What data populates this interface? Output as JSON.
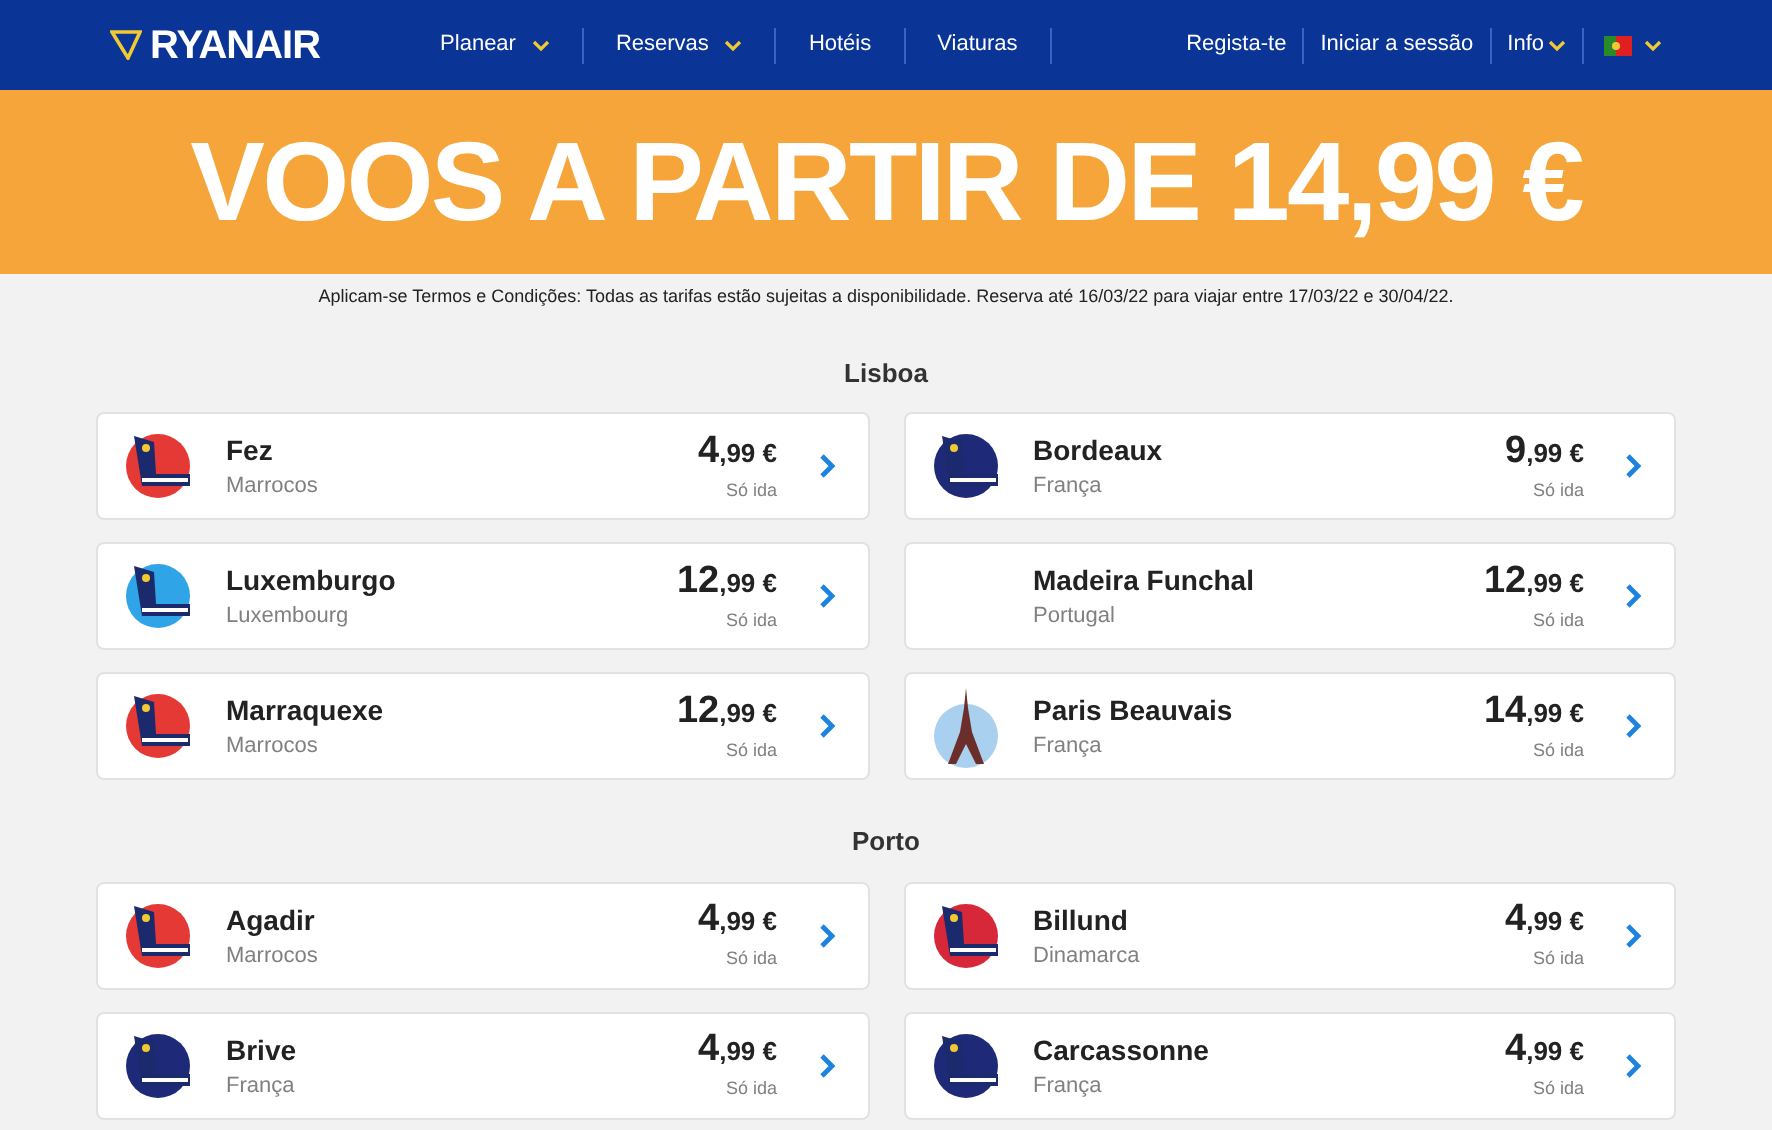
{
  "header": {
    "logo": "RYANAIR",
    "nav": [
      {
        "label": "Planear",
        "dropdown": true
      },
      {
        "label": "Reservas",
        "dropdown": true
      },
      {
        "label": "Hotéis",
        "dropdown": false
      },
      {
        "label": "Viaturas",
        "dropdown": false
      }
    ],
    "account": [
      {
        "label": "Regista-te",
        "dropdown": false
      },
      {
        "label": "Iniciar a sessão",
        "dropdown": false
      },
      {
        "label": "Info",
        "dropdown": true
      }
    ]
  },
  "banner": {
    "headline": "VOOS A PARTIR DE 14,99 €"
  },
  "terms": "Aplicam-se Termos e Condições: Todas as tarifas estão sujeitas a disponibilidade. Reserva até 16/03/22 para viajar entre 17/03/22 e 30/04/22.",
  "sections": [
    {
      "title": "Lisboa",
      "fares": [
        {
          "city": "Fez",
          "country": "Marrocos",
          "price_int": "4",
          "price_dec": ",99 €",
          "note": "Só ida",
          "kind": "tail",
          "color": "#e53935"
        },
        {
          "city": "Bordeaux",
          "country": "França",
          "price_int": "9",
          "price_dec": ",99 €",
          "note": "Só ida",
          "kind": "tail",
          "color": "#1e2a78"
        },
        {
          "city": "Luxemburgo",
          "country": "Luxembourg",
          "price_int": "12",
          "price_dec": ",99 €",
          "note": "Só ida",
          "kind": "tail",
          "color": "#2fa4e7"
        },
        {
          "city": "Madeira Funchal",
          "country": "Portugal",
          "price_int": "12",
          "price_dec": ",99 €",
          "note": "Só ida",
          "kind": "none"
        },
        {
          "city": "Marraquexe",
          "country": "Marrocos",
          "price_int": "12",
          "price_dec": ",99 €",
          "note": "Só ida",
          "kind": "tail",
          "color": "#e53935"
        },
        {
          "city": "Paris Beauvais",
          "country": "França",
          "price_int": "14",
          "price_dec": ",99 €",
          "note": "Só ida",
          "kind": "eiffel"
        }
      ]
    },
    {
      "title": "Porto",
      "fares": [
        {
          "city": "Agadir",
          "country": "Marrocos",
          "price_int": "4",
          "price_dec": ",99 €",
          "note": "Só ida",
          "kind": "tail",
          "color": "#e53935"
        },
        {
          "city": "Billund",
          "country": "Dinamarca",
          "price_int": "4",
          "price_dec": ",99 €",
          "note": "Só ida",
          "kind": "tail",
          "color": "#d62839"
        },
        {
          "city": "Brive",
          "country": "França",
          "price_int": "4",
          "price_dec": ",99 €",
          "note": "Só ida",
          "kind": "tail",
          "color": "#1e2a78"
        },
        {
          "city": "Carcassonne",
          "country": "França",
          "price_int": "4",
          "price_dec": ",99 €",
          "note": "Só ida",
          "kind": "tail",
          "color": "#1e2a78"
        }
      ]
    }
  ]
}
